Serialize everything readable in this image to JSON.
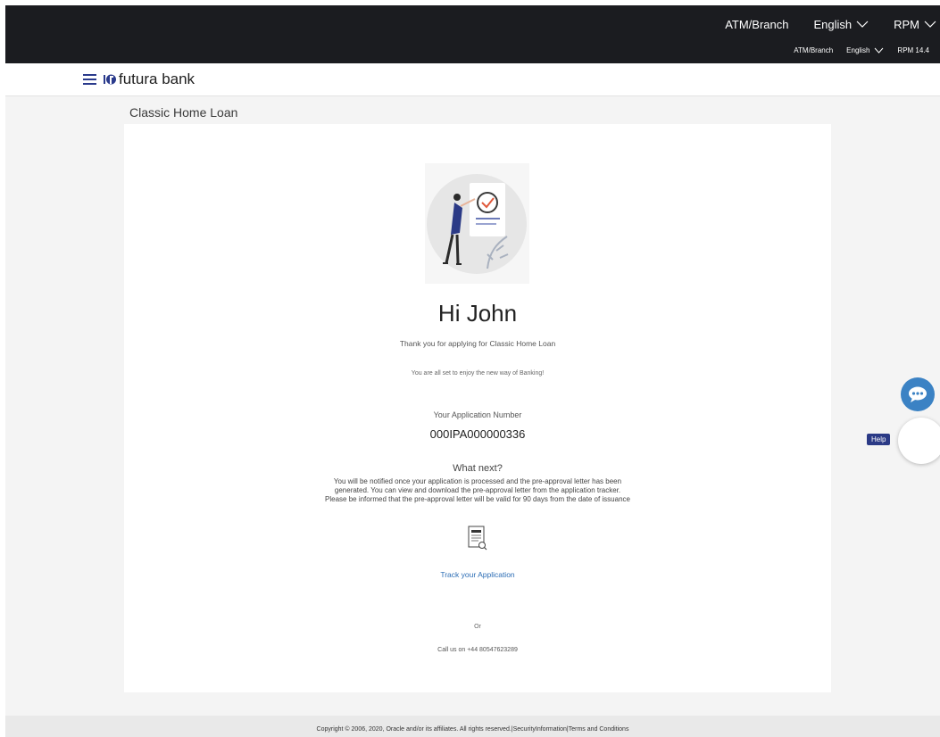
{
  "topbar": {
    "row1": {
      "atm_branch": "ATM/Branch",
      "language": "English",
      "user": "RPM"
    },
    "row2": {
      "atm_branch": "ATM/Branch",
      "language": "English",
      "user": "RPM 14.4"
    }
  },
  "header": {
    "brand": "futura bank"
  },
  "page": {
    "title": "Classic Home Loan"
  },
  "card": {
    "greeting": "Hi John",
    "thanks": "Thank you for applying for Classic Home Loan",
    "all_set": "You are all set to enjoy the new way of Banking!",
    "application_number_label": "Your Application Number",
    "application_number": "000IPA000000336",
    "what_next": "What next?",
    "notice_line1": "You will be notified once your application is processed and the pre-approval letter has been",
    "notice_line2": "generated. You can view and download the pre-approval letter from the application tracker.",
    "notice_line3": "Please be informed that the pre-approval letter will be valid for 90 days from the date of issuance",
    "track_link": "Track your Application",
    "or": "Or",
    "call": "Call us on +44 80547623289"
  },
  "help": {
    "label": "Help"
  },
  "footer": {
    "copyright": "Copyright © 2006, 2020, Oracle and/or its affiliates. All rights reserved.|",
    "security": "SecurityInformation",
    "separator": "|",
    "terms": "Terms and Conditions"
  },
  "colors": {
    "topbar": "#1b1c20",
    "accent": "#2b3a86",
    "link": "#2c6db5",
    "chat": "#3b82c4"
  }
}
